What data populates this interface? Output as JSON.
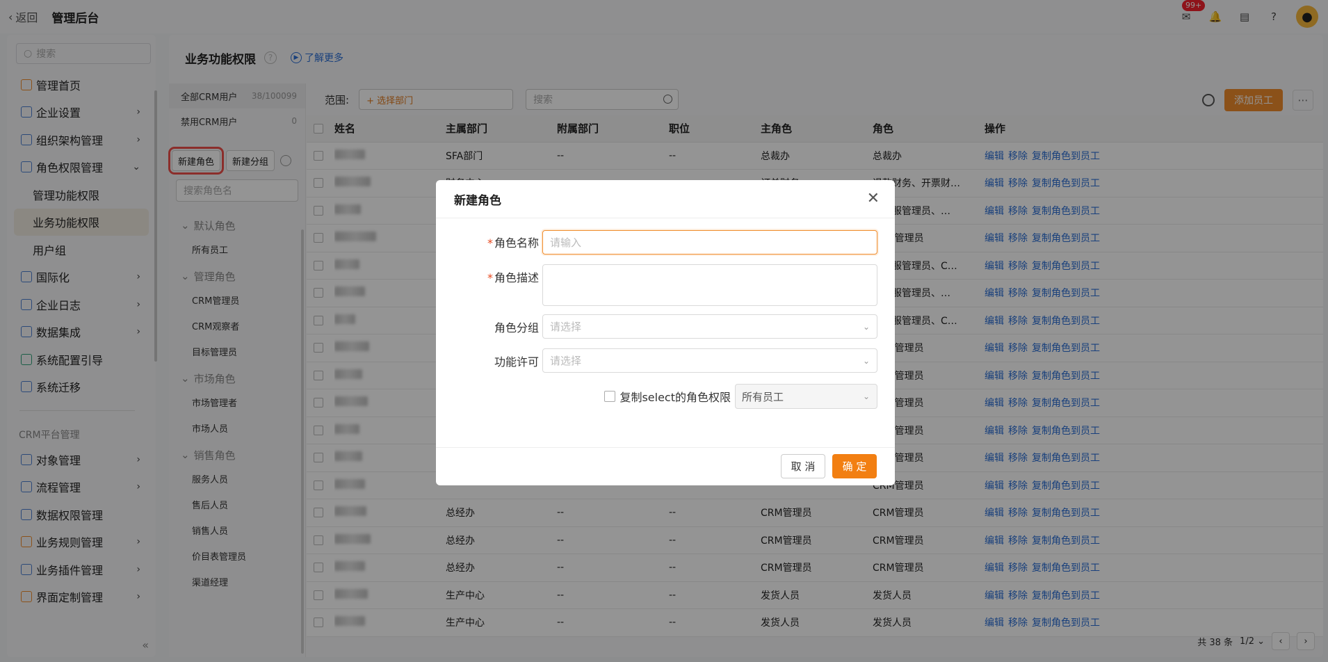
{
  "topbar": {
    "back": "返回",
    "title": "管理后台",
    "badge": "99+"
  },
  "sidebar": {
    "search_placeholder": "搜索",
    "items": [
      {
        "label": "管理首页",
        "icon": "home-icon"
      },
      {
        "label": "企业设置",
        "icon": "building-icon"
      },
      {
        "label": "组织架构管理",
        "icon": "org-icon"
      },
      {
        "label": "角色权限管理",
        "icon": "role-icon"
      }
    ],
    "subitems": [
      "管理功能权限",
      "业务功能权限",
      "用户组"
    ],
    "items2": [
      {
        "label": "国际化",
        "icon": "globe-icon"
      },
      {
        "label": "企业日志",
        "icon": "log-icon"
      },
      {
        "label": "数据集成",
        "icon": "integration-icon"
      },
      {
        "label": "系统配置引导",
        "icon": "guide-icon"
      },
      {
        "label": "系统迁移",
        "icon": "migrate-icon"
      }
    ],
    "section": "CRM平台管理",
    "items3": [
      {
        "label": "对象管理",
        "icon": "object-icon"
      },
      {
        "label": "流程管理",
        "icon": "flow-icon"
      },
      {
        "label": "数据权限管理",
        "icon": "data-perm-icon"
      },
      {
        "label": "业务规则管理",
        "icon": "rule-icon"
      },
      {
        "label": "业务插件管理",
        "icon": "plugin-icon"
      },
      {
        "label": "界面定制管理",
        "icon": "ui-icon"
      }
    ]
  },
  "main": {
    "title": "业务功能权限",
    "learn_more": "了解更多"
  },
  "roles": {
    "all_users": "全部CRM用户",
    "all_count": "38/100099",
    "disabled_users": "禁用CRM用户",
    "disabled_count": "0",
    "new_role": "新建角色",
    "new_group": "新建分组",
    "search_placeholder": "搜索角色名",
    "groups": [
      {
        "title": "默认角色",
        "items": [
          "所有员工"
        ]
      },
      {
        "title": "管理角色",
        "items": [
          "CRM管理员",
          "CRM观察者",
          "目标管理员"
        ]
      },
      {
        "title": "市场角色",
        "items": [
          "市场管理者",
          "市场人员"
        ]
      },
      {
        "title": "销售角色",
        "items": [
          "服务人员",
          "售后人员",
          "销售人员",
          "价目表管理员",
          "渠道经理"
        ]
      }
    ]
  },
  "table": {
    "scope_label": "范围:",
    "dept_button": "+ 选择部门",
    "search_placeholder": "搜索",
    "add_employee": "添加员工",
    "headers": [
      "姓名",
      "主属部门",
      "附属部门",
      "职位",
      "主角色",
      "角色",
      "操作"
    ],
    "actions": [
      "编辑",
      "移除",
      "复制角色到员工"
    ],
    "rows": [
      [
        "SFA部门",
        "--",
        "--",
        "总裁办",
        "总裁办"
      ],
      [
        "财务中心",
        "",
        "",
        "订单财务",
        "退款财务、开票财…"
      ],
      [
        "",
        "",
        "",
        "",
        "士客服管理员、…"
      ],
      [
        "",
        "",
        "",
        "",
        "CRM管理员"
      ],
      [
        "",
        "",
        "",
        "",
        "士客服管理员、C…"
      ],
      [
        "",
        "",
        "",
        "",
        "士客服管理员、…"
      ],
      [
        "",
        "",
        "",
        "",
        "士客服管理员、C…"
      ],
      [
        "",
        "",
        "",
        "",
        "CRM管理员"
      ],
      [
        "",
        "",
        "",
        "",
        "CRM管理员"
      ],
      [
        "",
        "",
        "",
        "",
        "CRM管理员"
      ],
      [
        "",
        "",
        "",
        "",
        "CRM管理员"
      ],
      [
        "",
        "",
        "",
        "",
        "CRM管理员"
      ],
      [
        "",
        "",
        "",
        "",
        "CRM管理员"
      ],
      [
        "总经办",
        "--",
        "--",
        "CRM管理员",
        "CRM管理员"
      ],
      [
        "总经办",
        "--",
        "--",
        "CRM管理员",
        "CRM管理员"
      ],
      [
        "总经办",
        "--",
        "--",
        "CRM管理员",
        "CRM管理员"
      ],
      [
        "生产中心",
        "--",
        "--",
        "发货人员",
        "发货人员"
      ],
      [
        "生产中心",
        "--",
        "--",
        "发货人员",
        "发货人员"
      ]
    ],
    "total": "共 38 条",
    "page": "1/2"
  },
  "modal": {
    "title": "新建角色",
    "name_label": "角色名称",
    "name_placeholder": "请输入",
    "desc_label": "角色描述",
    "group_label": "角色分组",
    "group_placeholder": "请选择",
    "perm_label": "功能许可",
    "perm_placeholder": "请选择",
    "copy_label": "复制select的角色权限",
    "copy_value": "所有员工",
    "cancel": "取 消",
    "ok": "确 定"
  }
}
